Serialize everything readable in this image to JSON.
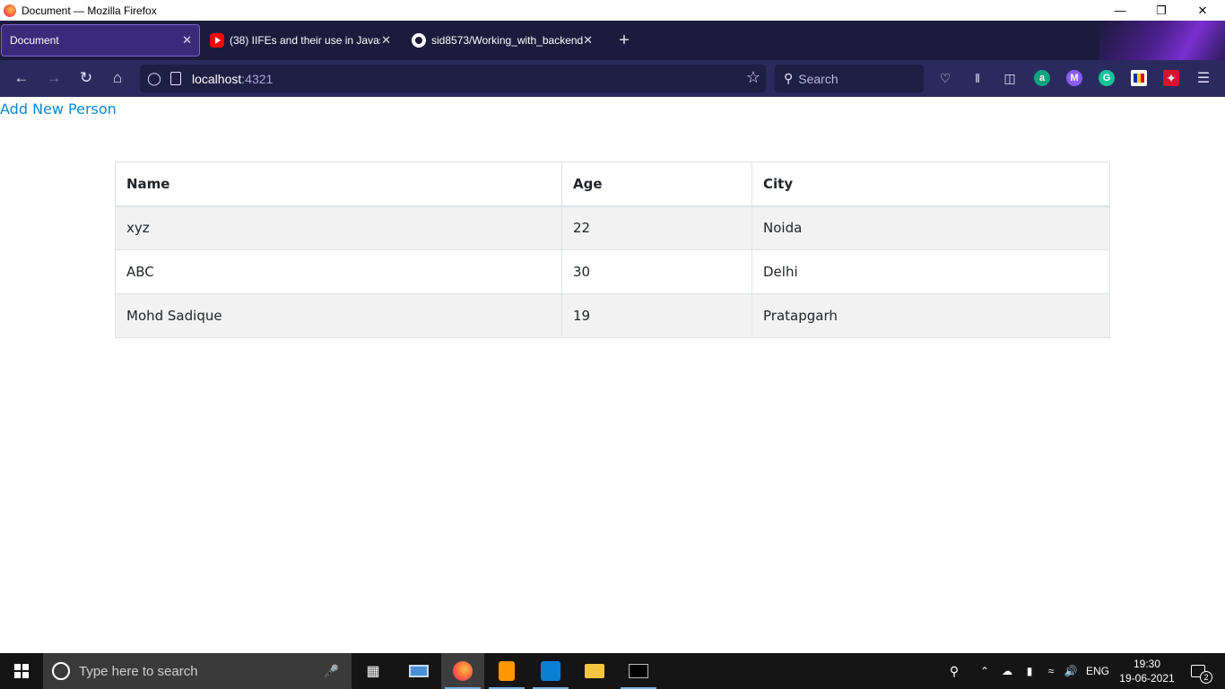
{
  "window": {
    "title": "Document — Mozilla Firefox"
  },
  "tabs": [
    {
      "label": "Document",
      "active": true
    },
    {
      "label": "(38) IIFEs and their use in Javasc",
      "active": false
    },
    {
      "label": "sid8573/Working_with_backend",
      "active": false
    }
  ],
  "urlbar": {
    "host": "localhost",
    "port": ":4321"
  },
  "search": {
    "placeholder": "Search"
  },
  "page": {
    "add_link": "Add New Person",
    "table": {
      "headers": [
        "Name",
        "Age",
        "City"
      ],
      "rows": [
        [
          "xyz",
          "22",
          "Noida"
        ],
        [
          "ABC",
          "30",
          "Delhi"
        ],
        [
          "Mohd Sadique",
          "19",
          "Pratapgarh"
        ]
      ]
    }
  },
  "taskbar": {
    "search_placeholder": "Type here to search",
    "language": "ENG",
    "time": "19:30",
    "date": "19-06-2021",
    "notification_count": "2"
  },
  "colors": {
    "tabstrip": "#1c1b3d",
    "navbar": "#2b2a5e",
    "link": "#0d87d1",
    "stripe": "#f2f2f2"
  }
}
